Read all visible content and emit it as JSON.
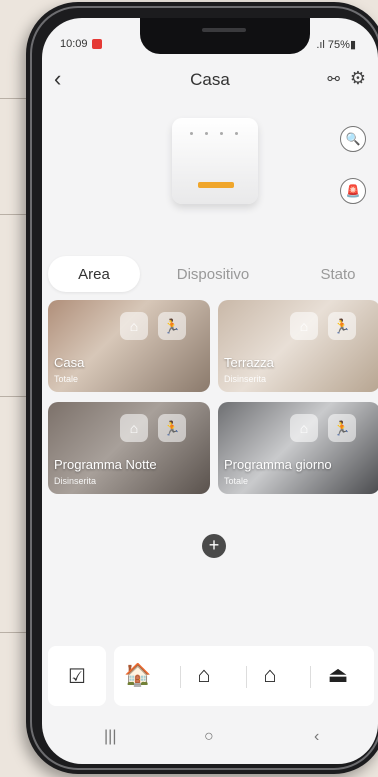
{
  "status_bar": {
    "time": "10:09",
    "battery": ".ıl 75%▮"
  },
  "header": {
    "title": "Casa",
    "back_icon": "chevron-left-icon",
    "share_icon": "share-icon",
    "settings_icon": "gear-icon"
  },
  "device": {
    "zoom_icon": "zoom-icon",
    "siren_icon": "siren-icon"
  },
  "tabs": [
    {
      "label": "Area",
      "active": true
    },
    {
      "label": "Dispositivo",
      "active": false
    },
    {
      "label": "Stato",
      "active": false
    }
  ],
  "areas": [
    {
      "name": "Casa",
      "state": "Totale",
      "active_mode": "away"
    },
    {
      "name": "Terrazza",
      "state": "Disinserita",
      "active_mode": "none"
    },
    {
      "name": "Programma Notte",
      "state": "Disinserita",
      "active_mode": "none"
    },
    {
      "name": "Programma giorno",
      "state": "Totale",
      "active_mode": "away"
    }
  ],
  "add_label": "+",
  "bottom_bar": {
    "select_icon": "checklist-icon",
    "buttons": [
      {
        "name": "arm-away-icon",
        "glyph": "⌂🚶"
      },
      {
        "name": "arm-home-icon",
        "glyph": "⌂"
      },
      {
        "name": "disarm-icon",
        "glyph": "⌂"
      },
      {
        "name": "panic-icon",
        "glyph": "⏏"
      }
    ]
  },
  "nav": {
    "recent": "|||",
    "home": "○",
    "back": "‹"
  },
  "colors": {
    "accent": "#4b6fc6",
    "background": "#f4f4f5"
  }
}
